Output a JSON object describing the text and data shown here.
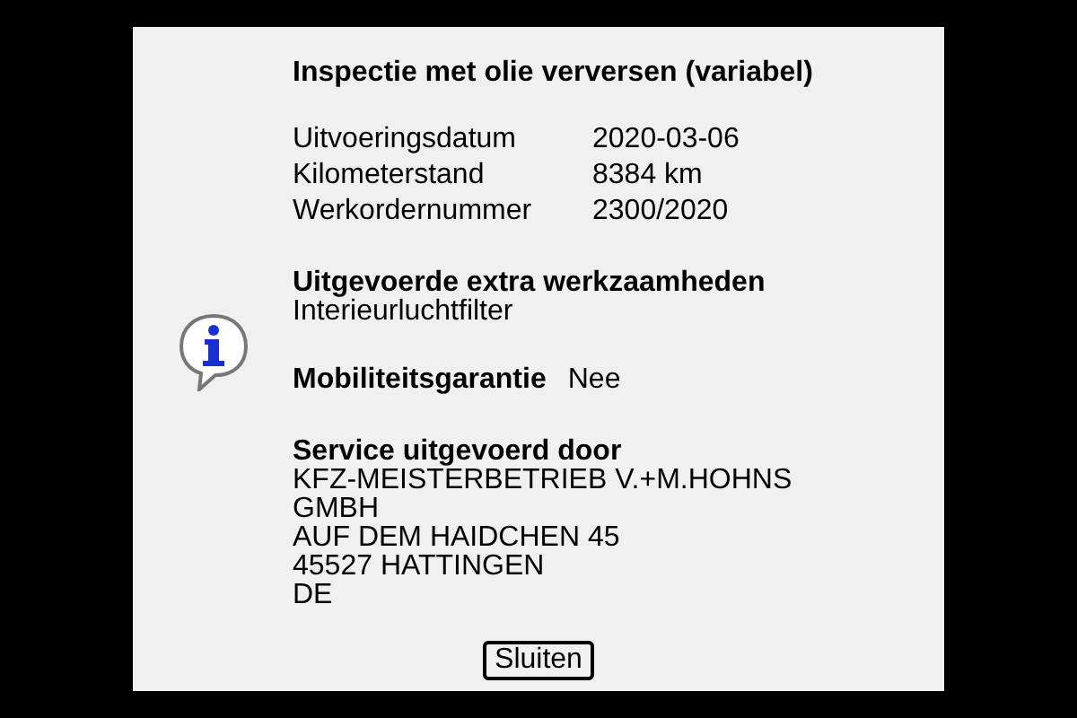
{
  "title": "Inspectie met olie verversen (variabel)",
  "details": [
    {
      "label": "Uitvoeringsdatum",
      "value": "2020-03-06"
    },
    {
      "label": "Kilometerstand",
      "value": "8384 km"
    },
    {
      "label": "Werkordernummer",
      "value": "2300/2020"
    }
  ],
  "extra_work": {
    "heading": "Uitgevoerde extra werkzaamheden",
    "items": [
      "Interieurluchtfilter"
    ]
  },
  "mobility": {
    "label": "Mobiliteitsgarantie",
    "value": "Nee"
  },
  "service": {
    "heading": "Service uitgevoerd door",
    "lines": [
      "KFZ-MEISTERBETRIEB V.+M.HOHNS GMBH",
      "AUF DEM HAIDCHEN 45",
      "45527 HATTINGEN",
      "DE"
    ]
  },
  "buttons": [
    "Sluiten"
  ]
}
